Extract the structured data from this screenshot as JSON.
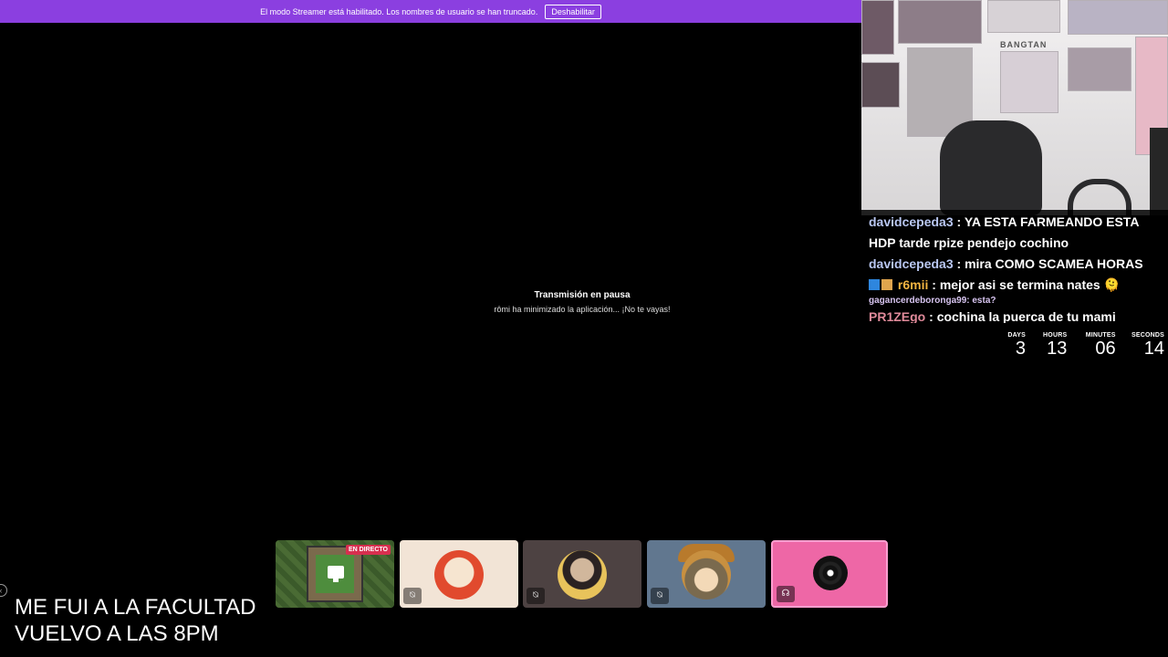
{
  "banner": {
    "text": "El modo Streamer está habilitado. Los nombres de usuario se han truncado.",
    "button": "Deshabilitar",
    "color": "#8b3fe0"
  },
  "paused": {
    "title": "Transmisión en pausa",
    "subtitle": "rômi ha minimizado la aplicación... ¡No te vayas!"
  },
  "webcam": {
    "poster_text": "BANGTAN"
  },
  "chat": {
    "messages": [
      {
        "user": "davidcepeda3",
        "sep": " : ",
        "text": "YA ESTA FARMEANDO ESTA HDP tarde rpize pendejo cochino"
      },
      {
        "user": "davidcepeda3",
        "sep": " : ",
        "text": "mira COMO SCAMEA HORAS"
      },
      {
        "user": "r6mii",
        "sep": " : ",
        "text": "mejor asi se termina nates 🫠"
      },
      {
        "user": "gagancerdeboronga99",
        "sep": ": ",
        "text": "esta?"
      },
      {
        "user": "PR1ZEgo",
        "sep": " : ",
        "text": "cochina la puerca de tu mami"
      }
    ]
  },
  "countdown": {
    "days_label": "DAYS",
    "days": "3",
    "hours_label": "HOURS",
    "hours": "13",
    "minutes_label": "MINUTES",
    "minutes": "06",
    "seconds_label": "SECONDS",
    "seconds": "14"
  },
  "tiles": {
    "live_badge": "EN DIRECTO",
    "icon_muted": "muted-mic-icon",
    "icon_headphones": "headphones-icon",
    "icon_screen": "screen-share-icon"
  },
  "away": {
    "line1": "ME FUI A LA FACULTAD",
    "line2": "VUELVO A LAS 8PM"
  }
}
